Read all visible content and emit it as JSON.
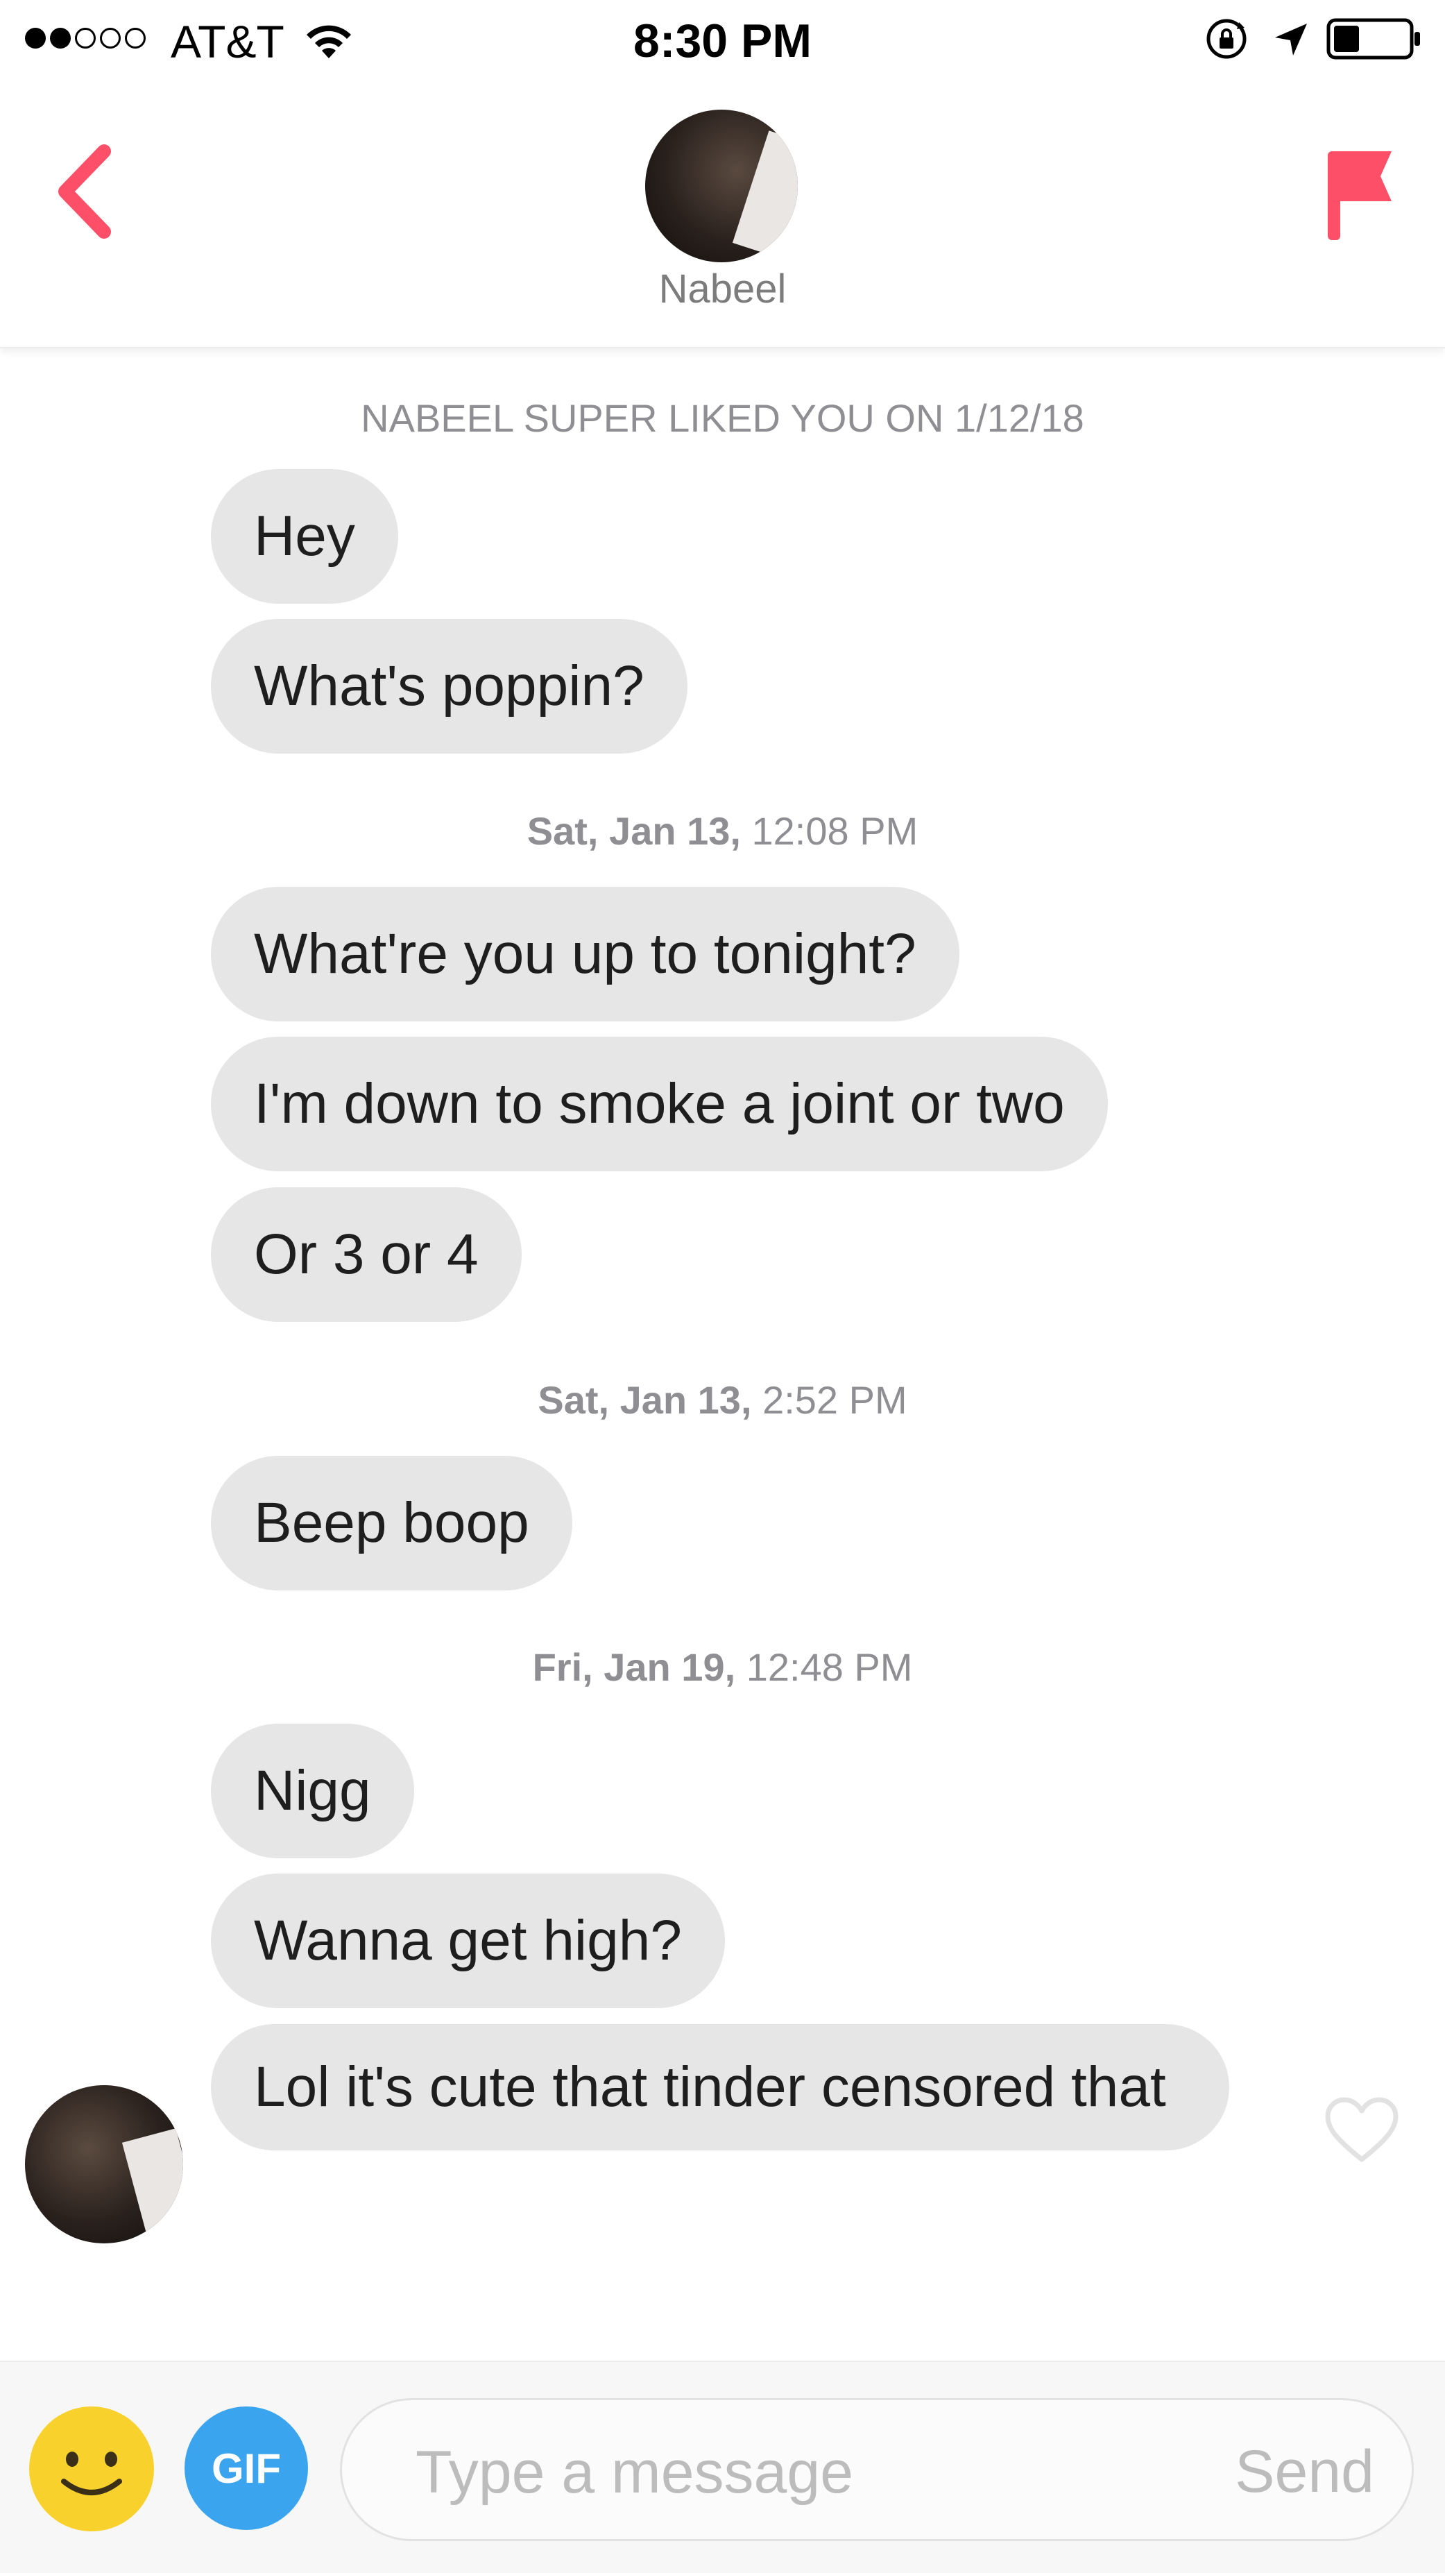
{
  "status_bar": {
    "carrier": "AT&T",
    "time": "8:30 PM",
    "signal_bars_filled": 2,
    "signal_bars_total": 5,
    "battery_level": 0.35,
    "icons": [
      "wifi-icon",
      "rotation-lock-icon",
      "location-arrow-icon",
      "battery-icon"
    ]
  },
  "header": {
    "back_icon": "chevron-left-icon",
    "name": "Nabeel",
    "flag_icon": "flag-icon",
    "accent_color": "#fd5068"
  },
  "messages": {
    "super_like_notice": "NABEEL SUPER LIKED YOU ON 1/12/18",
    "groups": [
      {
        "bubbles": [
          "Hey",
          "What's poppin?"
        ]
      },
      {
        "date": "Sat, Jan 13,",
        "time": "12:08 PM",
        "bubbles": [
          "What're you up to tonight?",
          "I'm down to smoke a joint or two",
          "Or 3 or 4"
        ]
      },
      {
        "date": "Sat, Jan 13,",
        "time": "2:52 PM",
        "bubbles": [
          "Beep boop"
        ]
      },
      {
        "date": "Fri, Jan 19,",
        "time": "12:48 PM",
        "bubbles": [
          "Nigg",
          "Wanna get high?",
          "Lol it's cute that tinder censored that"
        ]
      }
    ],
    "bubble_color": "#e6e6e6",
    "like_icon": "heart-outline-icon"
  },
  "composer": {
    "emoji_icon": "smiley-icon",
    "gif_label": "GIF",
    "placeholder": "Type a message",
    "value": "",
    "send_label": "Send",
    "emoji_color": "#f9d12c",
    "gif_color": "#3aa5ee"
  }
}
